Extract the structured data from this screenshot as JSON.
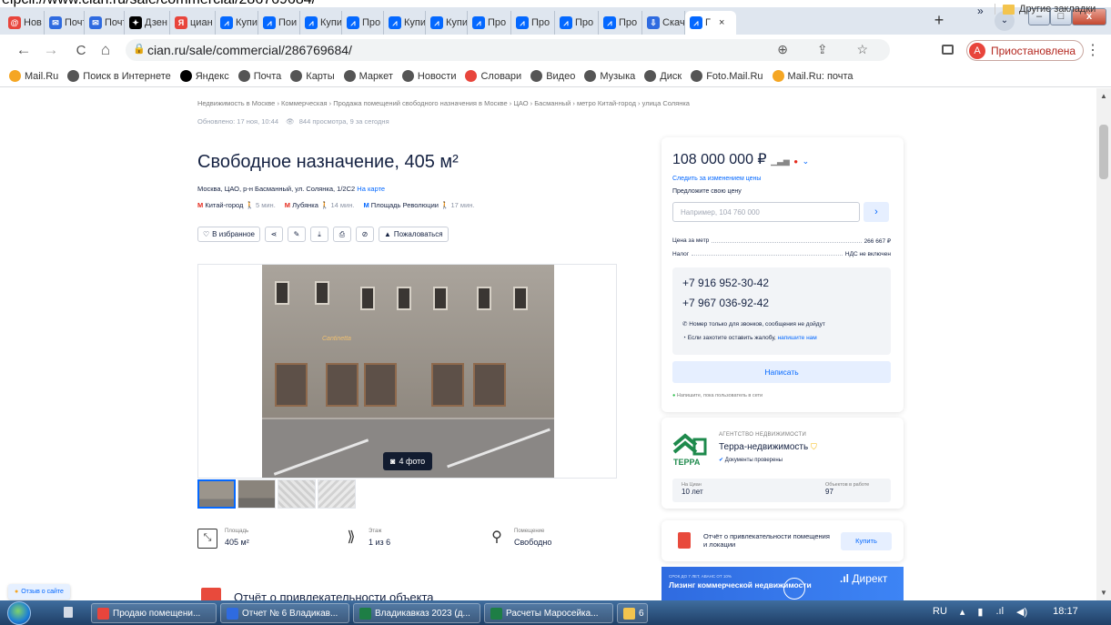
{
  "browser": {
    "top_caption": "eipcli.//www.cian.ru/sale/commercial/286769684/",
    "tabs": [
      {
        "label": "Нов",
        "color": "#e8453c",
        "glyph": "@"
      },
      {
        "label": "Почт",
        "color": "#2f6be0",
        "glyph": "✉"
      },
      {
        "label": "Почт",
        "color": "#2f6be0",
        "glyph": "✉"
      },
      {
        "label": "Дзен",
        "color": "#000000",
        "glyph": "✦"
      },
      {
        "label": "циан",
        "color": "#e8453c",
        "glyph": "Я"
      },
      {
        "label": "Купи",
        "color": "#0468ff",
        "glyph": "⩘"
      },
      {
        "label": "Пои",
        "color": "#0468ff",
        "glyph": "⩘"
      },
      {
        "label": "Купи",
        "color": "#0468ff",
        "glyph": "⩘"
      },
      {
        "label": "Про",
        "color": "#0468ff",
        "glyph": "⩘"
      },
      {
        "label": "Купи",
        "color": "#0468ff",
        "glyph": "⩘"
      },
      {
        "label": "Купи",
        "color": "#0468ff",
        "glyph": "⩘"
      },
      {
        "label": "Про",
        "color": "#0468ff",
        "glyph": "⩘"
      },
      {
        "label": "Про",
        "color": "#0468ff",
        "glyph": "⩘"
      },
      {
        "label": "Про",
        "color": "#0468ff",
        "glyph": "⩘"
      },
      {
        "label": "Про",
        "color": "#0468ff",
        "glyph": "⩘"
      },
      {
        "label": "Скач",
        "color": "#2f6be0",
        "glyph": "⇩"
      },
      {
        "label": "Г",
        "color": "#0468ff",
        "glyph": "⩘",
        "active": true
      }
    ],
    "tab_close": "×",
    "new_tab": "+",
    "tab_menu": "⌄",
    "window_buttons": {
      "min": "–",
      "max": "□",
      "close": "x"
    },
    "nav": {
      "back": "←",
      "forward": "→",
      "reload": "C",
      "home": "⌂"
    },
    "url": "cian.ru/sale/commercial/286769684/",
    "omni_actions": "⊕ ⇪ ☆",
    "profile": {
      "initial": "A",
      "label": "Приостановлена"
    },
    "menu": "⋮",
    "bookmarks": [
      {
        "label": "Mail.Ru",
        "color": "#f5a623"
      },
      {
        "label": "Поиск в Интернете",
        "color": "#555555"
      },
      {
        "label": "Яндекс",
        "color": "#000000"
      },
      {
        "label": "Почта",
        "color": "#555555"
      },
      {
        "label": "Карты",
        "color": "#555555"
      },
      {
        "label": "Маркет",
        "color": "#555555"
      },
      {
        "label": "Новости",
        "color": "#555555"
      },
      {
        "label": "Словари",
        "color": "#e8453c"
      },
      {
        "label": "Видео",
        "color": "#555555"
      },
      {
        "label": "Музыка",
        "color": "#555555"
      },
      {
        "label": "Диск",
        "color": "#555555"
      },
      {
        "label": "Foto.Mail.Ru",
        "color": "#555555"
      },
      {
        "label": "Mail.Ru: почта",
        "color": "#f5a623"
      }
    ],
    "bookmarks_more": "»",
    "other_bookmarks": "Другие закладки"
  },
  "page": {
    "breadcrumbs": "Недвижимость в Москве › Коммерческая › Продажа помещений свободного назначения в Москве › ЦАО › Басманный › метро Китай-город › улица Солянка",
    "updated": "Обновлено: 17 ноя, 10:44",
    "views": "844 просмотра, 9 за сегодня",
    "title": "Свободное назначение, 405 м²",
    "address": "Москва, ЦАО, р-н Басманный, ул. Солянка, 1/2С2",
    "map_link": "На карте",
    "metros": [
      {
        "name": "Китай-город",
        "time": "5 мин."
      },
      {
        "name": "Лубянка",
        "time": "14 мин."
      },
      {
        "name": "Площадь Революции",
        "time": "17 мин."
      }
    ],
    "actions": {
      "favorite": "В избранное",
      "complain": "Пожаловаться"
    },
    "gallery": {
      "badge": "4 фото",
      "sign": "Cantinetta"
    },
    "specs": [
      {
        "label": "Площадь",
        "value": "405 м²",
        "icon": "⤡"
      },
      {
        "label": "Этаж",
        "value": "1 из 6",
        "icon": "⟫"
      },
      {
        "label": "Помещение",
        "value": "Свободно",
        "icon": "⚲"
      }
    ],
    "report_title": "Отчёт о привлекательности объекта",
    "site_feedback": "Отзыв о сайте"
  },
  "price_card": {
    "price": "108 000 000 ₽",
    "follow": "Следить за изменением цены",
    "offer_label": "Предложите свою цену",
    "offer_placeholder": "Например, 104 760 000",
    "offer_go": "›",
    "rows": [
      {
        "label": "Цена за метр",
        "value": "266 667 ₽"
      },
      {
        "label": "Налог",
        "value": "НДС не включен"
      }
    ],
    "phones": [
      "+7 916 952-30-42",
      "+7 967 036-92-42"
    ],
    "calls_note": "Номер только для звонков, сообщения не дойдут",
    "complaint_note": "Если захотите оставить жалобу,",
    "complaint_link": "напишите нам",
    "write": "Написать",
    "online": "Напишите, пока пользователь в сети"
  },
  "agent_card": {
    "kind": "АГЕНТСТВО НЕДВИЖИМОСТИ",
    "name": "Терра-недвижимость",
    "docs": "Документы проверены",
    "logo_text": "TEPPA",
    "on_cian_label": "На Циан",
    "on_cian_value": "10 лет",
    "objects_label": "Объектов в работе",
    "objects_value": "97"
  },
  "attract_card": {
    "title": "Отчёт о привлекательности помещения и локации",
    "buy": "Купить"
  },
  "ad": {
    "small": "СРОК ДО 7 ЛЕТ, АВАНС ОТ 10%",
    "headline": "Лизинг коммерческой недвижимости",
    "brand": "Директ"
  },
  "taskbar": {
    "items": [
      {
        "label": "Продаю помещени...",
        "color": "#e8453c"
      },
      {
        "label": "Отчет № 6 Владикав...",
        "color": "#2f6be0"
      },
      {
        "label": "Владикавказ 2023 (д...",
        "color": "#1e7e45"
      },
      {
        "label": "Расчеты Маросейка...",
        "color": "#1e7e45"
      },
      {
        "label": "6",
        "color": "#f3c44e"
      }
    ],
    "lang": "RU",
    "time": "18:17"
  },
  "colors": {
    "accent": "#0468ff",
    "brand_text": "#152242",
    "metro": "#e52b1d"
  }
}
